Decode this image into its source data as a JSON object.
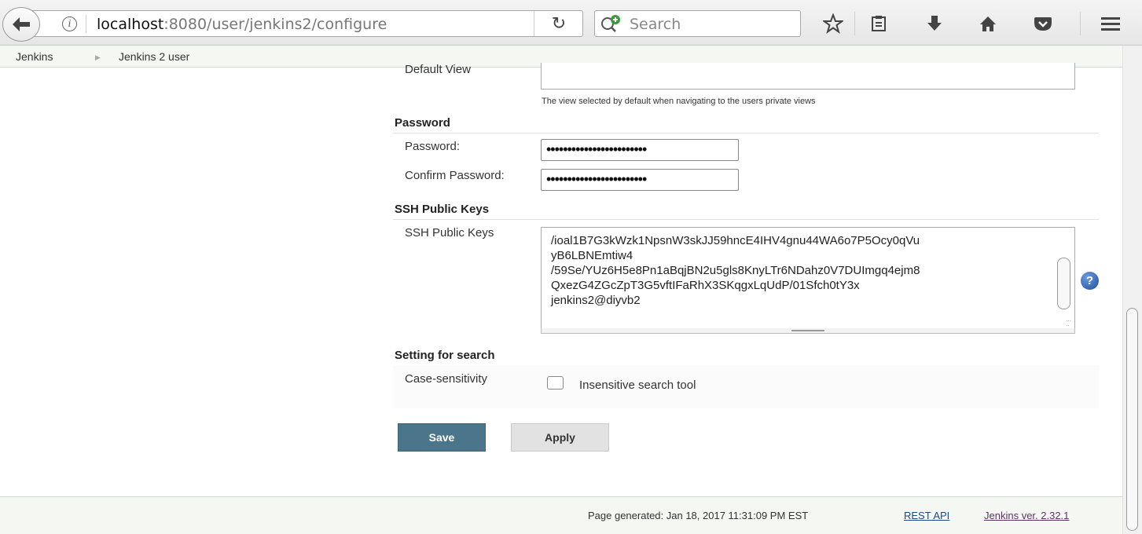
{
  "browser": {
    "url_host": "localhost",
    "url_path": ":8080/user/jenkins2/configure",
    "search_placeholder": "Search"
  },
  "breadcrumb": [
    "Jenkins",
    "Jenkins 2 user"
  ],
  "form": {
    "default_view_label": "Default View",
    "default_view_description": "The view selected by default when navigating to the users private views",
    "password_section": "Password",
    "password_label": "Password:",
    "password_value": "••••••••••••••••••••••••",
    "confirm_password_label": "Confirm Password:",
    "confirm_password_value": "••••••••••••••••••••••••",
    "ssh_section": "SSH Public Keys",
    "ssh_label": "SSH Public Keys",
    "ssh_lines": [
      "/ioal1B7G3kWzk1NpsnW3skJJ59hncE4IHV4gnu44WA6o7P5Ocy0qVu",
      "yB6LBNEmtiw4",
      "/59Se/YUz6H5e8Pn1aBqjBN2u5gls8KnyLTr6NDahz0V7DUImgq4ejm8",
      "QxezG4ZGcZpT3G5vftIFaRhX3SKqgxLqUdP/01Sfch0tY3x",
      "jenkins2@diyvb2"
    ],
    "search_section": "Setting for search",
    "case_label": "Case-sensitivity",
    "case_checkbox_label": "Insensitive search tool",
    "case_checked": false,
    "save_label": "Save",
    "apply_label": "Apply"
  },
  "footer": {
    "generated": "Page generated: Jan 18, 2017 11:31:09 PM EST",
    "rest_api": "REST API",
    "version": "Jenkins ver. 2.32.1"
  },
  "icons": {
    "back": "arrow-left-icon",
    "info": "info-icon",
    "reload": "reload-icon",
    "search": "search-add-icon",
    "bookmark": "star-icon",
    "reading_list": "clipboard-icon",
    "downloads": "download-arrow-icon",
    "home": "home-icon",
    "pocket": "pocket-icon",
    "menu": "hamburger-menu-icon",
    "help": "question-mark-icon"
  },
  "colors": {
    "save_button": "#4b758b",
    "link": "#204a87",
    "breadcrumb_bg": "#f5f7f2"
  }
}
